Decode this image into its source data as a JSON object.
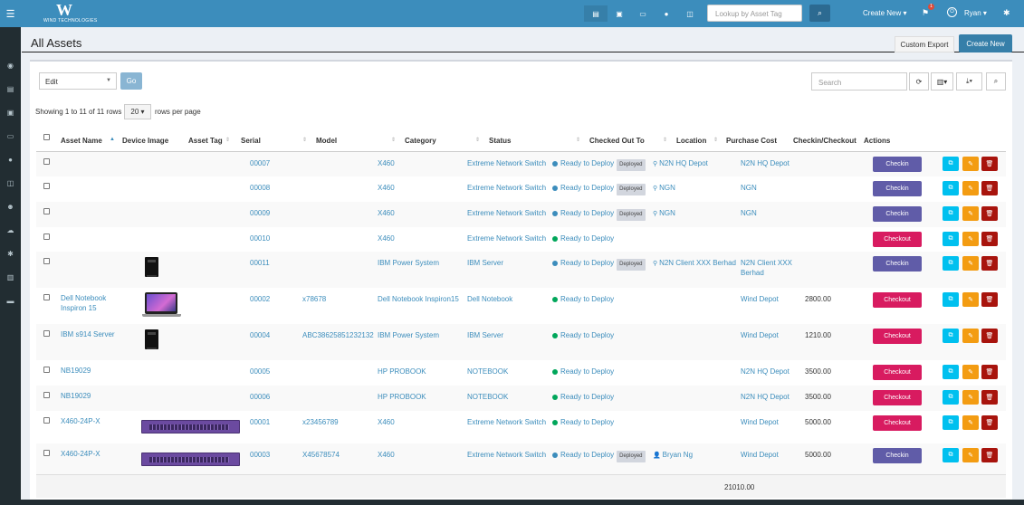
{
  "topbar": {
    "logo_sub": "WIND TECHNOLOGIES",
    "search_placeholder": "Lookup by Asset Tag",
    "create_new": "Create New ▾",
    "notif_count": "1",
    "user": "Ryan ▾"
  },
  "page": {
    "title": "All Assets",
    "custom_export": "Custom Export",
    "create_new": "Create New"
  },
  "toolbar": {
    "bulk_action": "Edit",
    "go": "Go",
    "search_placeholder": "Search"
  },
  "pagination": {
    "showing": "Showing 1 to 11 of 11 rows",
    "per_page": "20 ▾",
    "rows_per_page": "rows per page"
  },
  "columns": {
    "asset_name": "Asset Name",
    "device_image": "Device Image",
    "asset_tag": "Asset Tag",
    "serial": "Serial",
    "model": "Model",
    "category": "Category",
    "status": "Status",
    "checked_out_to": "Checked Out To",
    "location": "Location",
    "purchase_cost": "Purchase Cost",
    "checkin_checkout": "Checkin/Checkout",
    "actions": "Actions"
  },
  "rows": [
    {
      "name": "",
      "image": "",
      "tag": "00007",
      "serial": "",
      "model": "X460",
      "category": "Extreme Network Switch",
      "status": "Ready to Deploy",
      "deployed": "Deployed",
      "checked_out": "N2N HQ Depot",
      "checked_icon": "map-marker",
      "location": "N2N HQ Depot",
      "cost": "",
      "action": "Checkin"
    },
    {
      "name": "",
      "image": "",
      "tag": "00008",
      "serial": "",
      "model": "X460",
      "category": "Extreme Network Switch",
      "status": "Ready to Deploy",
      "deployed": "Deployed",
      "checked_out": "NGN",
      "checked_icon": "map-marker",
      "location": "NGN",
      "cost": "",
      "action": "Checkin"
    },
    {
      "name": "",
      "image": "",
      "tag": "00009",
      "serial": "",
      "model": "X460",
      "category": "Extreme Network Switch",
      "status": "Ready to Deploy",
      "deployed": "Deployed",
      "checked_out": "NGN",
      "checked_icon": "map-marker",
      "location": "NGN",
      "cost": "",
      "action": "Checkin"
    },
    {
      "name": "",
      "image": "",
      "tag": "00010",
      "serial": "",
      "model": "X460",
      "category": "Extreme Network Switch",
      "status": "Ready to Deploy",
      "deployed": "",
      "checked_out": "",
      "checked_icon": "",
      "location": "",
      "cost": "",
      "action": "Checkout"
    },
    {
      "name": "",
      "image": "server",
      "tag": "00011",
      "serial": "",
      "model": "IBM Power System",
      "category": "IBM Server",
      "status": "Ready to Deploy",
      "deployed": "Deployed",
      "checked_out": "N2N Client XXX Berhad",
      "checked_icon": "map-marker",
      "location": "N2N Client XXX Berhad",
      "cost": "",
      "action": "Checkin"
    },
    {
      "name": "Dell Notebook Inspiron 15",
      "image": "laptop",
      "tag": "00002",
      "serial": "x78678",
      "model": "Dell Notebook Inspiron15",
      "category": "Dell Notebook",
      "status": "Ready to Deploy",
      "deployed": "",
      "checked_out": "",
      "checked_icon": "",
      "location": "Wind Depot",
      "cost": "2800.00",
      "action": "Checkout"
    },
    {
      "name": "IBM s914 Server",
      "image": "server",
      "tag": "00004",
      "serial": "ABC38625851232132",
      "model": "IBM Power System",
      "category": "IBM Server",
      "status": "Ready to Deploy",
      "deployed": "",
      "checked_out": "",
      "checked_icon": "",
      "location": "Wind Depot",
      "cost": "1210.00",
      "action": "Checkout"
    },
    {
      "name": "NB19029",
      "image": "",
      "tag": "00005",
      "serial": "",
      "model": "HP PROBOOK",
      "category": "NOTEBOOK",
      "status": "Ready to Deploy",
      "deployed": "",
      "checked_out": "",
      "checked_icon": "",
      "location": "N2N HQ Depot",
      "cost": "3500.00",
      "action": "Checkout"
    },
    {
      "name": "NB19029",
      "image": "",
      "tag": "00006",
      "serial": "",
      "model": "HP PROBOOK",
      "category": "NOTEBOOK",
      "status": "Ready to Deploy",
      "deployed": "",
      "checked_out": "",
      "checked_icon": "",
      "location": "N2N HQ Depot",
      "cost": "3500.00",
      "action": "Checkout"
    },
    {
      "name": "X460-24P-X",
      "image": "switch",
      "tag": "00001",
      "serial": "x23456789",
      "model": "X460",
      "category": "Extreme Network Switch",
      "status": "Ready to Deploy",
      "deployed": "",
      "checked_out": "",
      "checked_icon": "",
      "location": "Wind Depot",
      "cost": "5000.00",
      "action": "Checkout"
    },
    {
      "name": "X460-24P-X",
      "image": "switch",
      "tag": "00003",
      "serial": "X45678574",
      "model": "X460",
      "category": "Extreme Network Switch",
      "status": "Ready to Deploy",
      "deployed": "Deployed",
      "checked_out": "Bryan Ng",
      "checked_icon": "user",
      "location": "Wind Depot",
      "cost": "5000.00",
      "action": "Checkin"
    }
  ],
  "footer": {
    "total_cost": "21010.00"
  },
  "colors": {
    "header": "#3c8dbc",
    "sidebar": "#222d32",
    "checkin": "#605ca8",
    "checkout": "#d81b60",
    "status_deployed_dot": "#3c8dbc",
    "status_ready_dot": "#00a65a",
    "clone": "#00c0ef",
    "edit": "#f39c12",
    "delete": "#a8140d"
  }
}
